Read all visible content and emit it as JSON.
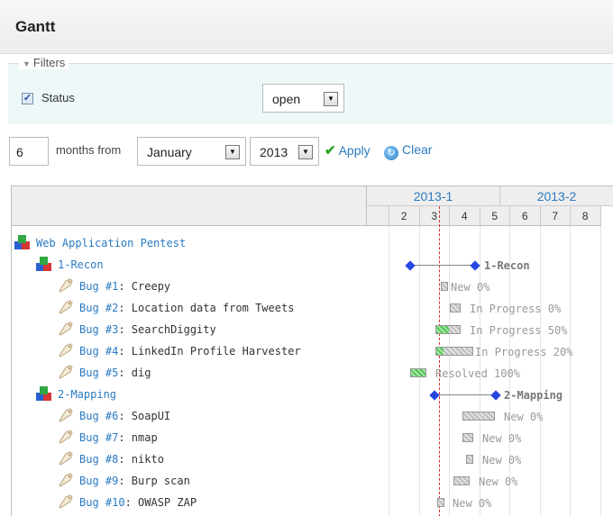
{
  "page_title": "Gantt",
  "filters": {
    "legend": "Filters",
    "status_label": "Status",
    "status_checked": true,
    "status_value": "open"
  },
  "controls": {
    "months": "6",
    "months_from_label": "months from",
    "month": "January",
    "year": "2013",
    "apply_label": "Apply",
    "clear_label": "Clear"
  },
  "timeline": {
    "months": [
      {
        "label": "2013-1"
      },
      {
        "label": "2013-2"
      }
    ],
    "weeks": [
      "",
      "2",
      "3",
      "4",
      "5",
      "6",
      "7",
      "8"
    ]
  },
  "project": {
    "name": "Web Application Pentest"
  },
  "rows": [
    {
      "kind": "version",
      "name": "1-Recon"
    },
    {
      "kind": "issue",
      "name": "Bug #1",
      "rest": ": Creepy",
      "status": "New",
      "progress": "0%"
    },
    {
      "kind": "issue",
      "name": "Bug #2",
      "rest": ": Location data from Tweets",
      "status": "In Progress",
      "progress": "0%"
    },
    {
      "kind": "issue",
      "name": "Bug #3",
      "rest": ": SearchDiggity",
      "status": "In Progress",
      "progress": "50%"
    },
    {
      "kind": "issue",
      "name": "Bug #4",
      "rest": ": LinkedIn Profile Harvester",
      "status": "In Progress",
      "progress": "20%"
    },
    {
      "kind": "issue",
      "name": "Bug #5",
      "rest": ": dig",
      "status": "Resolved",
      "progress": "100%"
    },
    {
      "kind": "version",
      "name": "2-Mapping"
    },
    {
      "kind": "issue",
      "name": "Bug #6",
      "rest": ": SoapUI",
      "status": "New",
      "progress": "0%"
    },
    {
      "kind": "issue",
      "name": "Bug #7",
      "rest": ": nmap",
      "status": "New",
      "progress": "0%"
    },
    {
      "kind": "issue",
      "name": "Bug #8",
      "rest": ": nikto",
      "status": "New",
      "progress": "0%"
    },
    {
      "kind": "issue",
      "name": "Bug #9",
      "rest": ": Burp scan",
      "status": "New",
      "progress": "0%"
    },
    {
      "kind": "issue",
      "name": "Bug #10",
      "rest": ": OWASP ZAP",
      "status": "New",
      "progress": "0%"
    }
  ],
  "colors": {
    "link": "#2a7ac1",
    "done_bar": "#55c155",
    "todo_bar": "#bdbdbd",
    "today_line": "#d92b2b",
    "milestone": "#2646e0"
  }
}
